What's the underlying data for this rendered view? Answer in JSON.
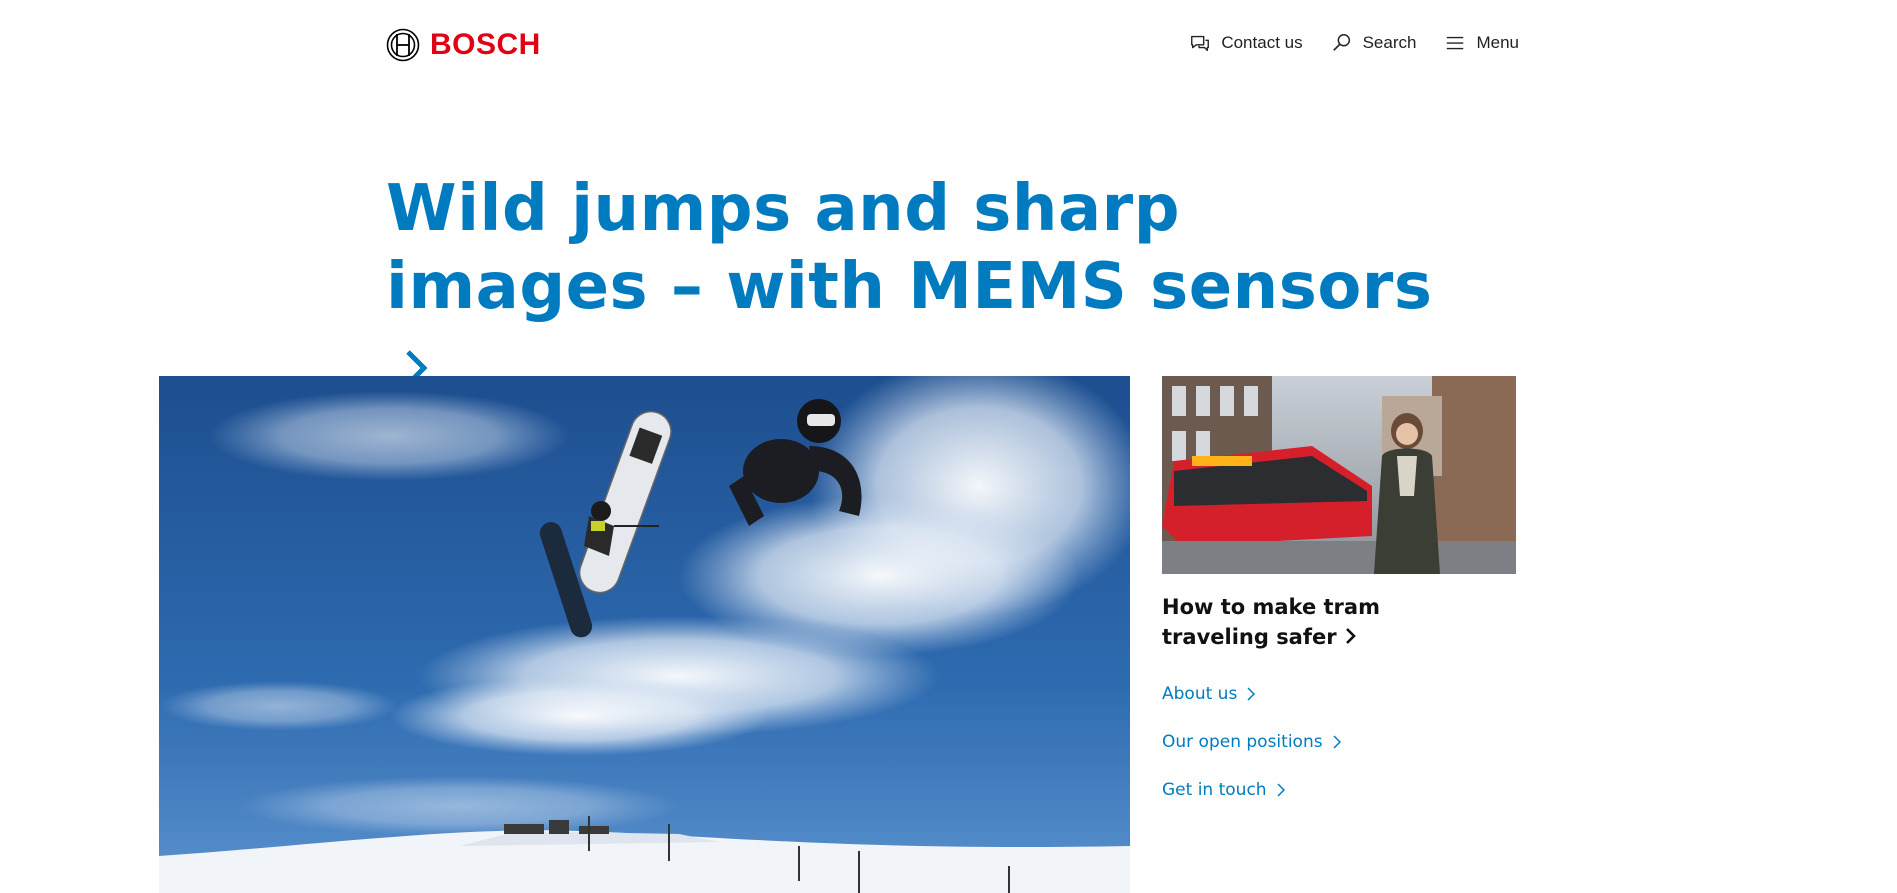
{
  "header": {
    "brand": "BOSCH",
    "nav": [
      {
        "label": "Contact us",
        "icon": "chat-icon"
      },
      {
        "label": "Search",
        "icon": "search-icon"
      },
      {
        "label": "Menu",
        "icon": "hamburger-icon"
      }
    ]
  },
  "hero": {
    "headline": "Wild jumps and sharp images – with MEMS sensors"
  },
  "side": {
    "card_title": "How to make tram traveling safer",
    "links": [
      "About us",
      "Our open positions",
      "Get in touch"
    ]
  },
  "colors": {
    "brand_red": "#e20015",
    "link_blue": "#007bc0",
    "sky_blue": "#1f5a9c",
    "tram_red": "#d5202c"
  }
}
